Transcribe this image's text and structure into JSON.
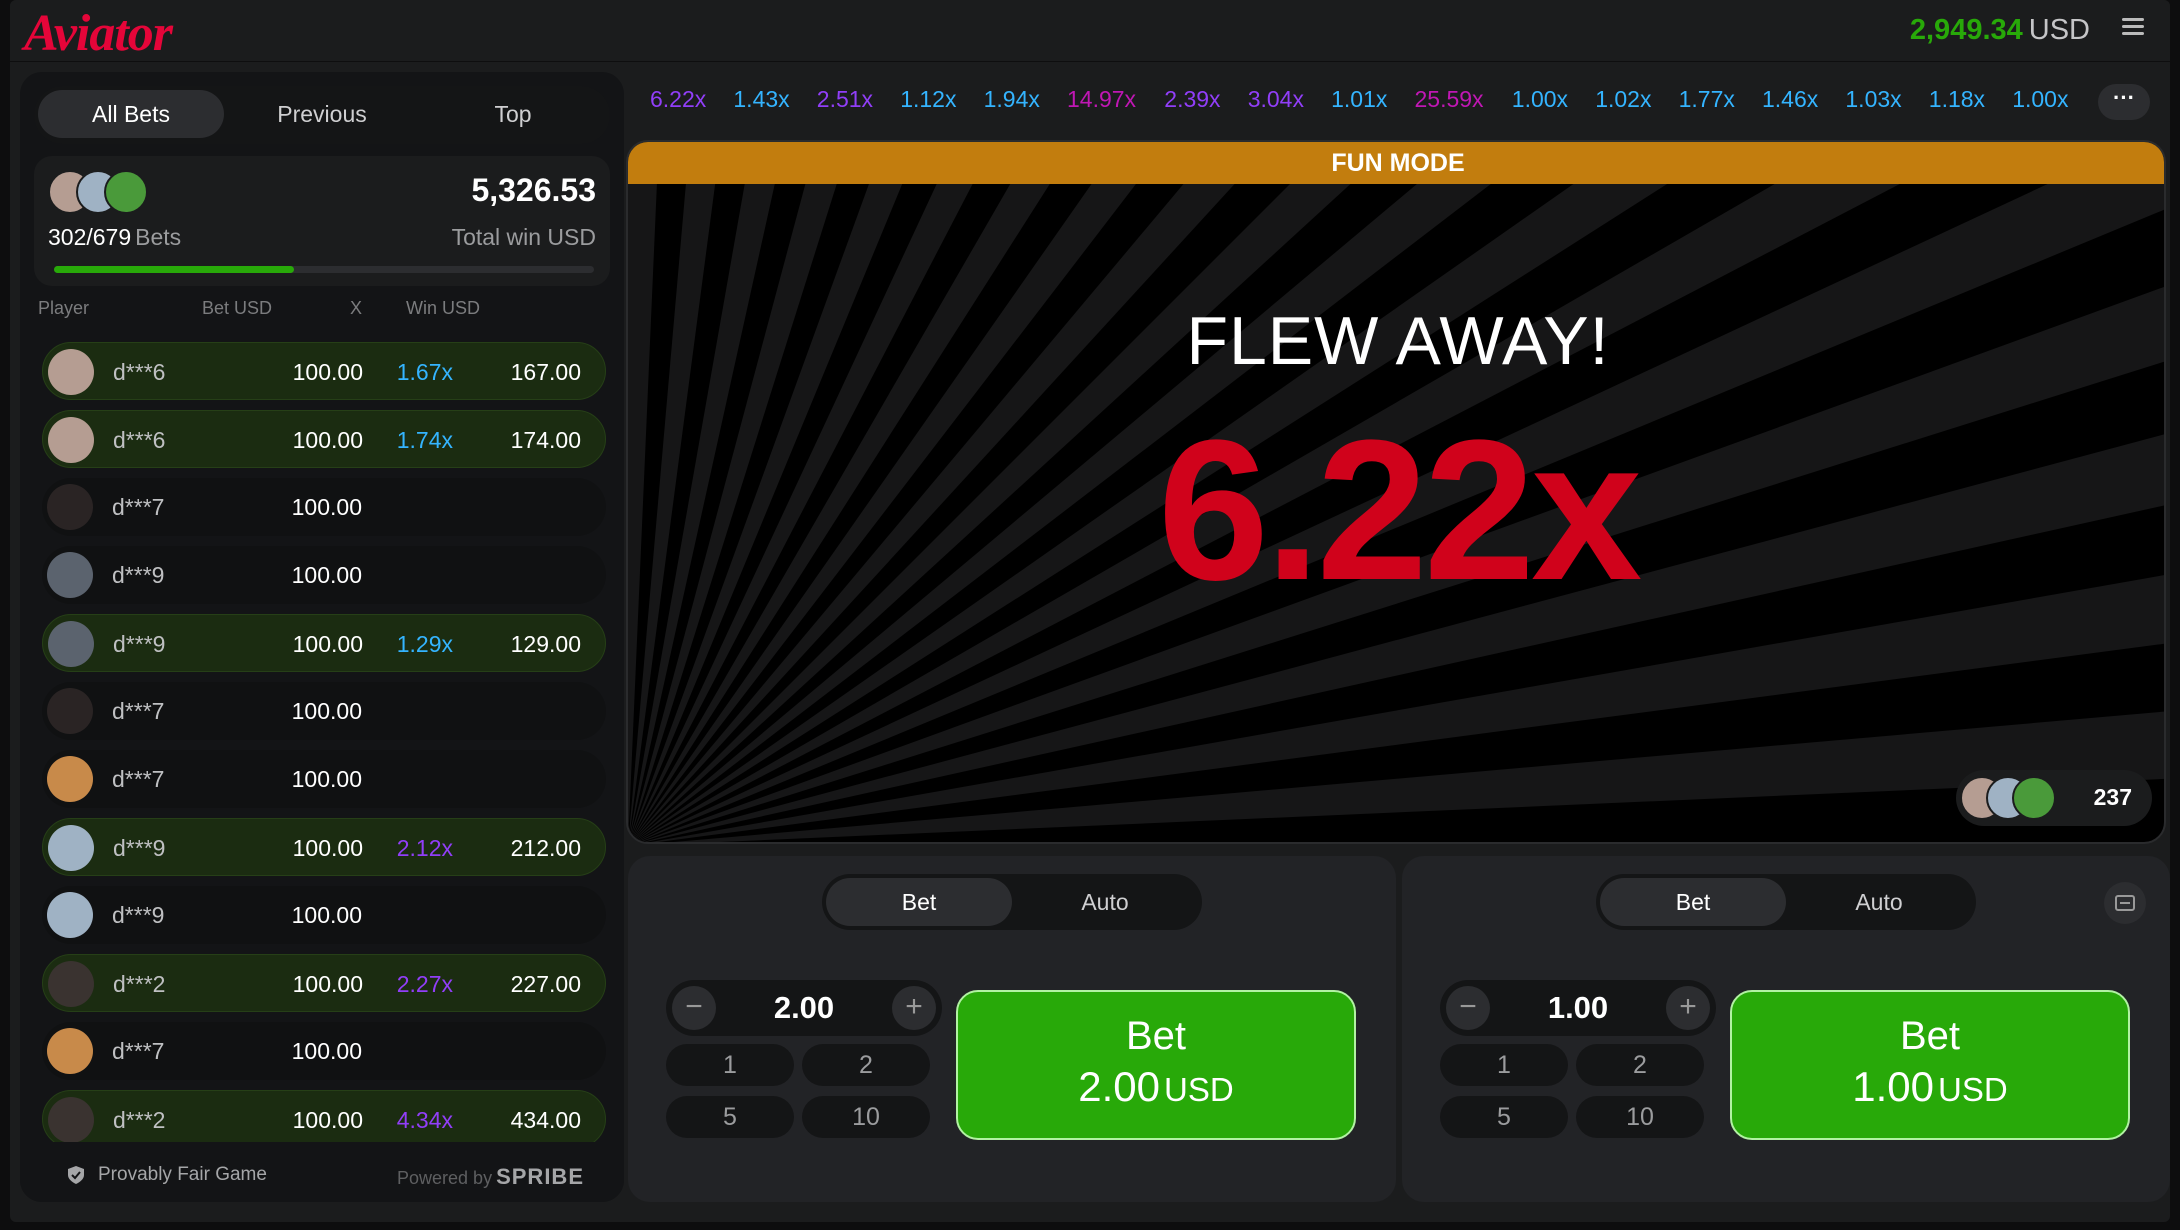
{
  "header": {
    "logo": "Aviator",
    "balance": "2,949.34",
    "currency": "USD"
  },
  "left_panel": {
    "tabs": [
      "All Bets",
      "Previous",
      "Top"
    ],
    "active_tab": "All Bets",
    "bets_count": "302/679",
    "bets_label": "Bets",
    "total_win": "5,326.53",
    "total_win_label": "Total win USD",
    "progress": 0.445,
    "columns": [
      "Player",
      "Bet USD",
      "X",
      "Win USD"
    ],
    "rows": [
      {
        "name": "d***6",
        "bet": "100.00",
        "mult": "1.67x",
        "win": "167.00",
        "won": true,
        "mult_color": "#34b4ff",
        "avatar": "#b59d92"
      },
      {
        "name": "d***6",
        "bet": "100.00",
        "mult": "1.74x",
        "win": "174.00",
        "won": true,
        "mult_color": "#34b4ff",
        "avatar": "#b59d92"
      },
      {
        "name": "d***7",
        "bet": "100.00",
        "mult": "",
        "win": "",
        "won": false,
        "mult_color": "#34b4ff",
        "avatar": "#2a2424"
      },
      {
        "name": "d***9",
        "bet": "100.00",
        "mult": "",
        "win": "",
        "won": false,
        "mult_color": "#34b4ff",
        "avatar": "#5b636e"
      },
      {
        "name": "d***9",
        "bet": "100.00",
        "mult": "1.29x",
        "win": "129.00",
        "won": true,
        "mult_color": "#34b4ff",
        "avatar": "#5b636e"
      },
      {
        "name": "d***7",
        "bet": "100.00",
        "mult": "",
        "win": "",
        "won": false,
        "mult_color": "#34b4ff",
        "avatar": "#2a2424"
      },
      {
        "name": "d***7",
        "bet": "100.00",
        "mult": "",
        "win": "",
        "won": false,
        "mult_color": "#34b4ff",
        "avatar": "#c88a4a"
      },
      {
        "name": "d***9",
        "bet": "100.00",
        "mult": "2.12x",
        "win": "212.00",
        "won": true,
        "mult_color": "#913ef8",
        "avatar": "#9fb2c4"
      },
      {
        "name": "d***9",
        "bet": "100.00",
        "mult": "",
        "win": "",
        "won": false,
        "mult_color": "#34b4ff",
        "avatar": "#9fb2c4"
      },
      {
        "name": "d***2",
        "bet": "100.00",
        "mult": "2.27x",
        "win": "227.00",
        "won": true,
        "mult_color": "#913ef8",
        "avatar": "#3a3330"
      },
      {
        "name": "d***7",
        "bet": "100.00",
        "mult": "",
        "win": "",
        "won": false,
        "mult_color": "#34b4ff",
        "avatar": "#c88a4a"
      },
      {
        "name": "d***2",
        "bet": "100.00",
        "mult": "4.34x",
        "win": "434.00",
        "won": true,
        "mult_color": "#913ef8",
        "avatar": "#3a3330"
      }
    ],
    "footer_left": "Provably Fair Game",
    "powered_by": "Powered by",
    "brand": "SPRIBE"
  },
  "history": [
    {
      "v": "6.22x",
      "c": "#913ef8"
    },
    {
      "v": "1.43x",
      "c": "#34b4ff"
    },
    {
      "v": "2.51x",
      "c": "#913ef8"
    },
    {
      "v": "1.12x",
      "c": "#34b4ff"
    },
    {
      "v": "1.94x",
      "c": "#34b4ff"
    },
    {
      "v": "14.97x",
      "c": "#c017b4"
    },
    {
      "v": "2.39x",
      "c": "#913ef8"
    },
    {
      "v": "3.04x",
      "c": "#913ef8"
    },
    {
      "v": "1.01x",
      "c": "#34b4ff"
    },
    {
      "v": "25.59x",
      "c": "#c017b4"
    },
    {
      "v": "1.00x",
      "c": "#34b4ff"
    },
    {
      "v": "1.02x",
      "c": "#34b4ff"
    },
    {
      "v": "1.77x",
      "c": "#34b4ff"
    },
    {
      "v": "1.46x",
      "c": "#34b4ff"
    },
    {
      "v": "1.03x",
      "c": "#34b4ff"
    },
    {
      "v": "1.18x",
      "c": "#34b4ff"
    },
    {
      "v": "1.00x",
      "c": "#34b4ff"
    }
  ],
  "history_more": "···",
  "game": {
    "banner": "FUN MODE",
    "status": "FLEW AWAY!",
    "multiplier": "6.22x",
    "online_count": "237"
  },
  "bet_panels": [
    {
      "tabs": [
        "Bet",
        "Auto"
      ],
      "active": "Bet",
      "amount": "2.00",
      "quick": [
        "1",
        "2",
        "5",
        "10"
      ],
      "button_label": "Bet",
      "button_amount": "2.00",
      "button_currency": "USD"
    },
    {
      "tabs": [
        "Bet",
        "Auto"
      ],
      "active": "Bet",
      "amount": "1.00",
      "quick": [
        "1",
        "2",
        "5",
        "10"
      ],
      "button_label": "Bet",
      "button_amount": "1.00",
      "button_currency": "USD"
    }
  ],
  "colors": {
    "brand_red": "#e50539",
    "win_green": "#28a909",
    "fun_mode": "#c27d0e",
    "crash_red": "#d0021b"
  }
}
